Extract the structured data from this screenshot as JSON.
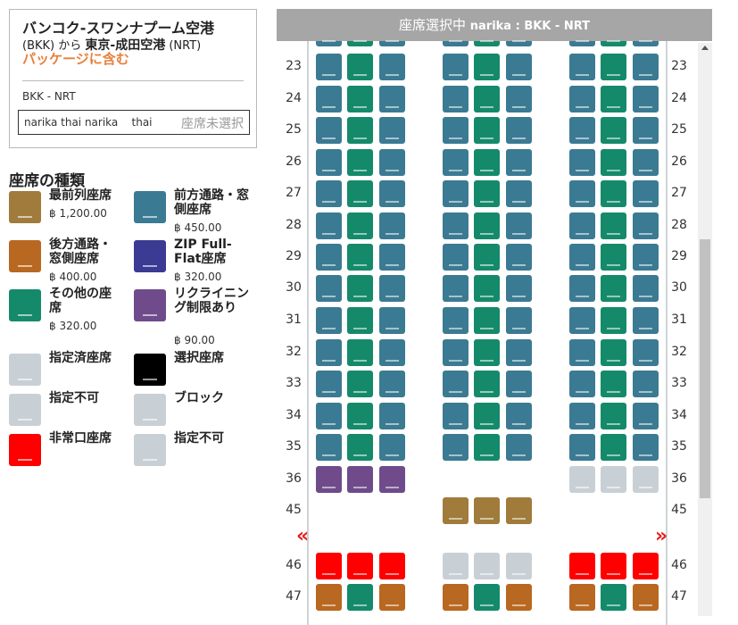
{
  "flight": {
    "title": "バンコク-スワンナプーム空港",
    "origin_code": "(BKK)",
    "from_text": " から ",
    "destination": "東京-成田空港",
    "destination_code": " (NRT)",
    "package_label": "パッケージに含む",
    "route_code": "BKK - NRT",
    "passenger_name": "narika thai narika    thai",
    "seat_status": "座席未選択"
  },
  "legend": {
    "title": "座席の種類",
    "items": [
      {
        "label": "最前列座席",
        "price": "฿ 1,200.00",
        "color": "#a07b3b"
      },
      {
        "label": "前方通路・窓側座席",
        "price": "฿ 450.00",
        "color": "#3b7a93"
      },
      {
        "label": "後方通路・窓側座席",
        "price": "฿ 400.00",
        "color": "#b86820"
      },
      {
        "label": "ZIP Full-Flat座席",
        "price": "฿ 320.00",
        "color": "#3b3b94"
      },
      {
        "label": "その他の座席",
        "price": "฿ 320.00",
        "color": "#148a6a"
      },
      {
        "label": "リクライニング制限あり",
        "price": "฿ 90.00",
        "color": "#6f4b8b"
      },
      {
        "label": "指定済座席",
        "price": "",
        "color": "#c9d0d5"
      },
      {
        "label": "選択座席",
        "price": "",
        "color": "#000000"
      },
      {
        "label": "指定不可",
        "price": "",
        "color": "#c9d0d5"
      },
      {
        "label": "ブロック",
        "price": "",
        "color": "#c9d0d5"
      },
      {
        "label": "非常口座席",
        "price": "",
        "color": "#ff0000"
      },
      {
        "label": "指定不可",
        "price": "",
        "color": "#c9d0d5"
      }
    ]
  },
  "seat_map": {
    "header_prefix": "座席選択中 ",
    "header_detail": "narika : BKK - NRT",
    "exit_arrow_left": "«",
    "exit_arrow_right": "»",
    "rows": [
      {
        "num": "23",
        "seats": "BGB BGB BGB"
      },
      {
        "num": "24",
        "seats": "BGB BGB BGB"
      },
      {
        "num": "25",
        "seats": "BGB BGB BGB"
      },
      {
        "num": "26",
        "seats": "BGB BGB BGB"
      },
      {
        "num": "27",
        "seats": "BGB BGB BGB"
      },
      {
        "num": "28",
        "seats": "BGB BGB BGB"
      },
      {
        "num": "29",
        "seats": "BGB BGB BGB"
      },
      {
        "num": "30",
        "seats": "BGB BGB BGB"
      },
      {
        "num": "31",
        "seats": "BGB BGB BGB"
      },
      {
        "num": "32",
        "seats": "BGB BGB BGB"
      },
      {
        "num": "33",
        "seats": "BGB BGB BGB"
      },
      {
        "num": "34",
        "seats": "BGB BGB BGB"
      },
      {
        "num": "35",
        "seats": "BGB BGB BGB"
      },
      {
        "num": "36",
        "seats": "PPP ___ LLL"
      },
      {
        "num": "45",
        "seats": "___ FFF ___"
      },
      {
        "num": "46",
        "seats": "RRR LLL RRR"
      },
      {
        "num": "47",
        "seats": "OGO OGO OGO"
      }
    ]
  },
  "colors": {
    "B": "#3b7a93",
    "G": "#148a6a",
    "P": "#6f4b8b",
    "L": "#c9d0d5",
    "F": "#a07b3b",
    "R": "#ff0000",
    "O": "#b86820"
  }
}
